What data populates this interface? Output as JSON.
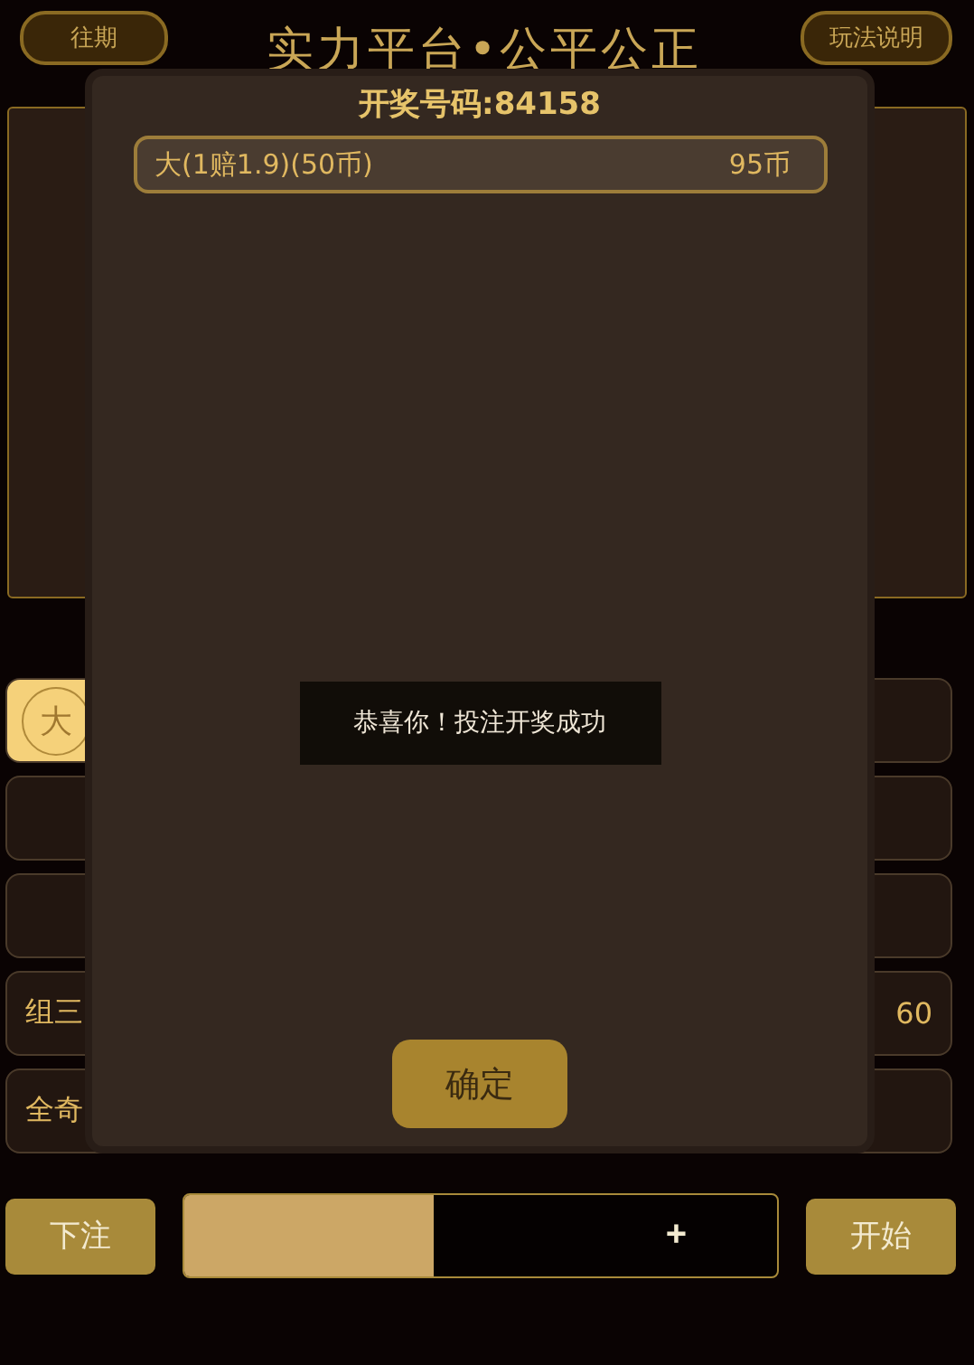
{
  "header": {
    "history_button": "往期",
    "title": "实力平台•公平公正",
    "rules_button": "玩法说明"
  },
  "options": [
    {
      "label": "大",
      "kind": "circle",
      "selected": true
    },
    {
      "selected": false
    },
    {
      "selected": false
    },
    {
      "selected": false
    },
    {
      "selected": false
    },
    {
      "selected": false
    },
    {
      "label": "组三",
      "kind": "text",
      "selected": false
    },
    {
      "label": "60",
      "kind": "text",
      "selected": false
    },
    {
      "label": "全奇",
      "kind": "text",
      "selected": false
    },
    {
      "selected": false
    }
  ],
  "bottom_bar": {
    "bet_button": "下注",
    "amount": {
      "level": 0.42,
      "plus": "+"
    },
    "start_button": "开始"
  },
  "dialog": {
    "title": "开奖号码:84158",
    "results": [
      {
        "bet": "大(1赔1.9)(50币)",
        "payout": "95币"
      }
    ],
    "toast": "恭喜你！投注开奖成功",
    "confirm_button": "确定"
  }
}
